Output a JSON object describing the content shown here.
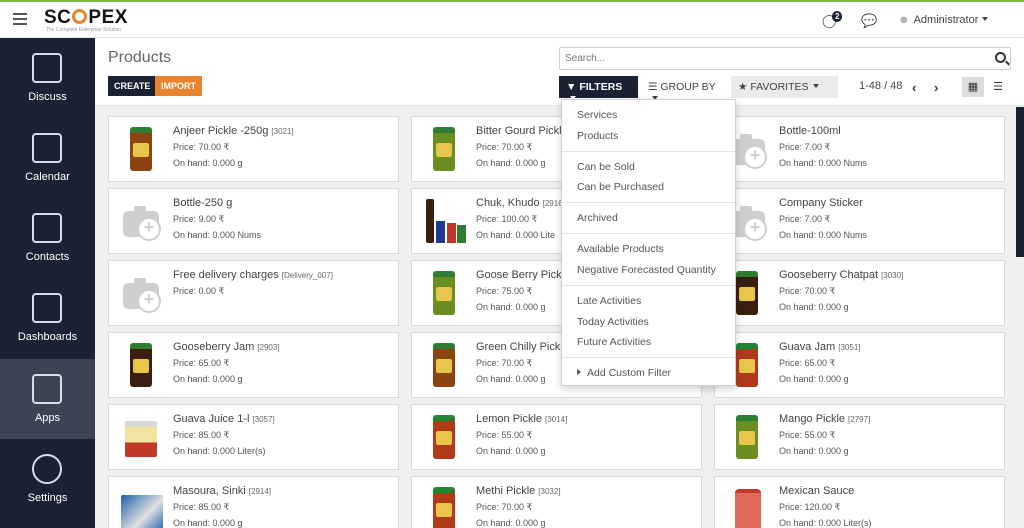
{
  "topbar": {
    "logo_pre": "SC",
    "logo_post": "PEX",
    "tagline": "The Complete Enterprise Solution",
    "notifications_count": "2",
    "user_name": "Administrator"
  },
  "sidebar": {
    "items": [
      {
        "label": "Discuss"
      },
      {
        "label": "Calendar"
      },
      {
        "label": "Contacts"
      },
      {
        "label": "Dashboards"
      },
      {
        "label": "Apps"
      },
      {
        "label": "Settings"
      }
    ]
  },
  "control": {
    "title": "Products",
    "create_label": "CREATE",
    "import_label": "IMPORT",
    "search_placeholder": "Search...",
    "filters_label": "FILTERS",
    "group_by_label": "GROUP BY",
    "favorites_label": "FAVORITES",
    "pager": "1-48 / 48"
  },
  "filters_menu": {
    "items": [
      "Services",
      "Products",
      "Can be Sold",
      "Can be Purchased",
      "Archived",
      "Available Products",
      "Negative Forecasted Quantity",
      "Late Activities",
      "Today Activities",
      "Future Activities",
      "Add Custom Filter"
    ]
  },
  "products": [
    {
      "name": "Anjeer Pickle -250g",
      "ref": "[3021]",
      "price": "Price: 70.00 ₹",
      "onhand": "On hand: 0.000 g",
      "image": "jar"
    },
    {
      "name": "Bitter Gourd Pickl",
      "ref": "",
      "price": "Price: 70.00 ₹",
      "onhand": "On hand: 0.000 g",
      "image": "jar-green"
    },
    {
      "name": "Bottle-100ml",
      "ref": "",
      "price": "Price: 7.00 ₹",
      "onhand": "On hand: 0.000 Nums",
      "image": "placeholder"
    },
    {
      "name": "Bottle-250 g",
      "ref": "",
      "price": "Price: 9.00 ₹",
      "onhand": "On hand: 0.000 Nums",
      "image": "placeholder"
    },
    {
      "name": "Chuk, Khudo",
      "ref": "[2916",
      "price": "Price: 100.00 ₹",
      "onhand": "On hand: 0.000 Lite",
      "image": "bottles"
    },
    {
      "name": "Company Sticker",
      "ref": "",
      "price": "Price: 7.00 ₹",
      "onhand": "On hand: 0.000 Nums",
      "image": "placeholder"
    },
    {
      "name": "Free delivery charges",
      "ref": "[Delivery_007]",
      "price": "Price: 0.00 ₹",
      "onhand": "",
      "image": "placeholder"
    },
    {
      "name": "Goose Berry Pickl",
      "ref": "",
      "price": "Price: 75.00 ₹",
      "onhand": "On hand: 0.000 g",
      "image": "jar-green"
    },
    {
      "name": "Gooseberry Chatpat",
      "ref": "[3030]",
      "price": "Price: 70.00 ₹",
      "onhand": "On hand: 0.000 g",
      "image": "jar-dark"
    },
    {
      "name": "Gooseberry Jam",
      "ref": "[2903]",
      "price": "Price: 65.00 ₹",
      "onhand": "On hand: 0.000 g",
      "image": "jar-dark"
    },
    {
      "name": "Green Chilly Pickl",
      "ref": "",
      "price": "Price: 70.00 ₹",
      "onhand": "On hand: 0.000 g",
      "image": "jar"
    },
    {
      "name": "Guava Jam",
      "ref": "[3051]",
      "price": "Price: 65.00 ₹",
      "onhand": "On hand: 0.000 g",
      "image": "jar-red"
    },
    {
      "name": "Guava Juice 1-l",
      "ref": "[3057]",
      "price": "Price: 85.00 ₹",
      "onhand": "On hand: 0.000 Liter(s)",
      "image": "tin"
    },
    {
      "name": "Lemon Pickle",
      "ref": "[3014]",
      "price": "Price: 55.00 ₹",
      "onhand": "On hand: 0.000 g",
      "image": "jar-red"
    },
    {
      "name": "Mango Pickle",
      "ref": "[2797]",
      "price": "Price: 55.00 ₹",
      "onhand": "On hand: 0.000 g",
      "image": "jar-green"
    },
    {
      "name": "Masoura, Sinki",
      "ref": "[2914]",
      "price": "Price: 85.00 ₹",
      "onhand": "On hand: 0.000 g",
      "image": "bag"
    },
    {
      "name": "Methi Pickle",
      "ref": "[3032]",
      "price": "Price: 70.00 ₹",
      "onhand": "On hand: 0.000 g",
      "image": "jar-red"
    },
    {
      "name": "Mexican Sauce",
      "ref": "",
      "price": "Price: 120.00 ₹",
      "onhand": "On hand: 0.000 Liter(s)",
      "image": "jug"
    }
  ],
  "colors": {
    "sidebar_bg": "#1a2233",
    "sidebar_active": "#3b4453",
    "import_btn": "#e8842d",
    "topbar_accent": "#7fbf3f"
  }
}
